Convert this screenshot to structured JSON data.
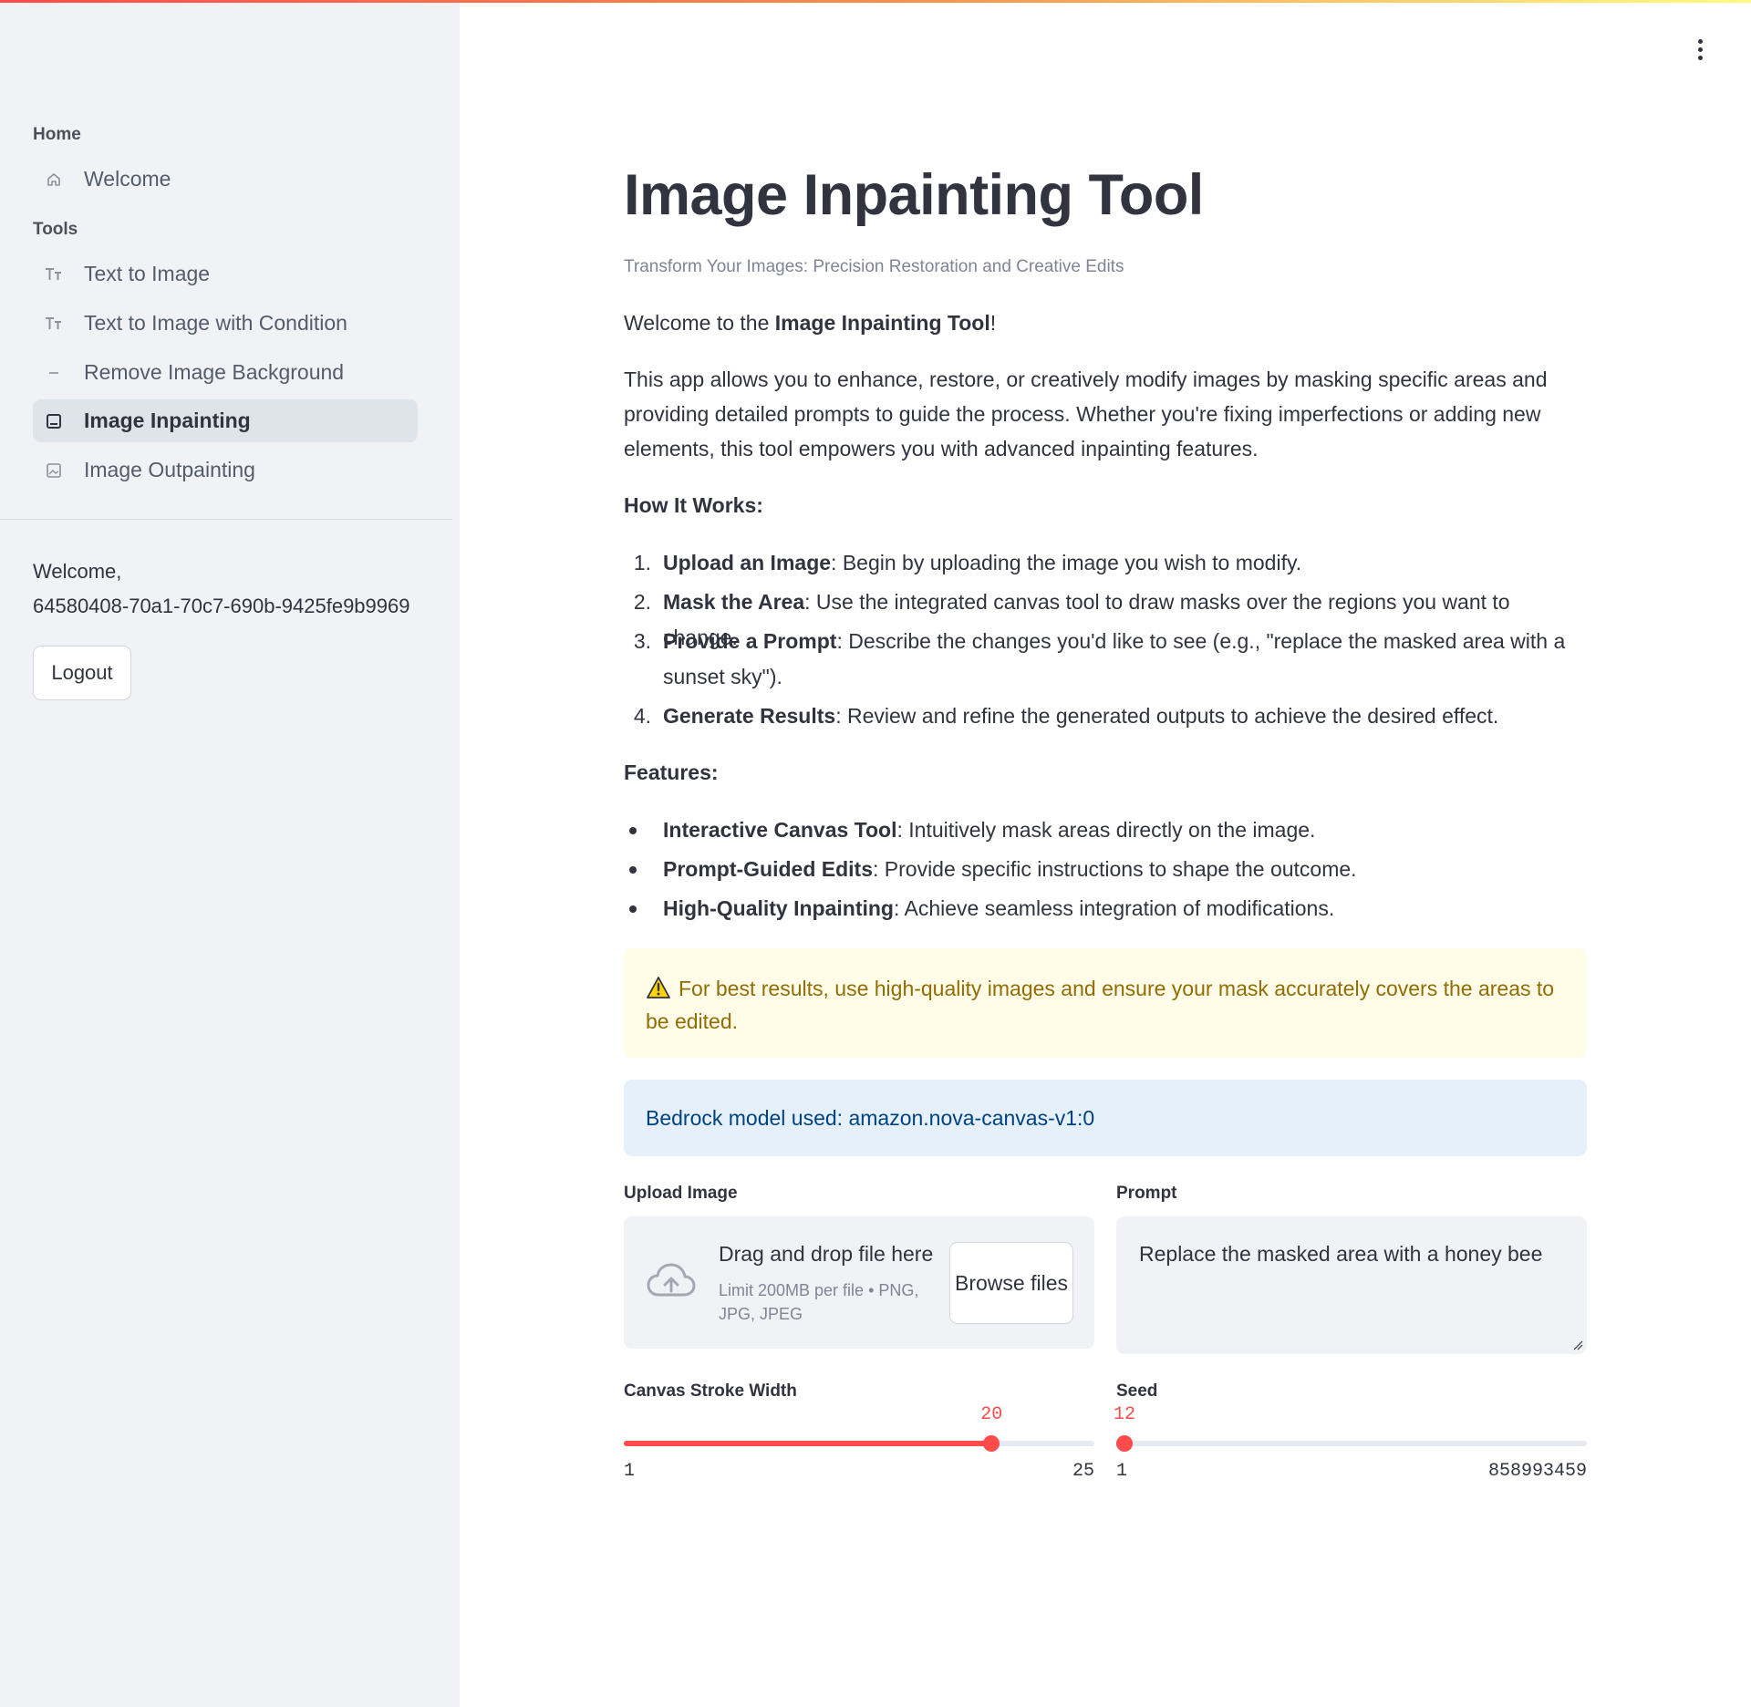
{
  "colors": {
    "primary": "#ff4b4b",
    "sidebar_bg": "#f0f2f6",
    "warning_bg": "#fffce7",
    "warning_text": "#926c05",
    "info_bg": "#e5f0fb",
    "info_text": "#004280"
  },
  "sidebar": {
    "sections": [
      {
        "title": "Home",
        "items": [
          {
            "label": "Welcome",
            "icon": "home-icon",
            "active": false
          }
        ]
      },
      {
        "title": "Tools",
        "items": [
          {
            "label": "Text to Image",
            "icon": "text-size-icon",
            "active": false
          },
          {
            "label": "Text to Image with Condition",
            "icon": "text-size-icon",
            "active": false
          },
          {
            "label": "Remove Image Background",
            "icon": "dash-icon",
            "active": false
          },
          {
            "label": "Image Inpainting",
            "icon": "image-icon",
            "active": true
          },
          {
            "label": "Image Outpainting",
            "icon": "image-icon",
            "active": false
          }
        ]
      }
    ],
    "welcome_label": "Welcome,",
    "user_id": "64580408-70a1-70c7-690b-9425fe9b9969",
    "logout_label": "Logout"
  },
  "main": {
    "title": "Image Inpainting Tool",
    "subtitle": "Transform Your Images: Precision Restoration and Creative Edits",
    "intro_prefix": "Welcome to the ",
    "intro_bold": "Image Inpainting Tool",
    "intro_suffix": "!",
    "description": "This app allows you to enhance, restore, or creatively modify images by masking specific areas and providing detailed prompts to guide the process. Whether you're fixing imperfections or adding new elements, this tool empowers you with advanced inpainting features.",
    "how_it_works_heading": "How It Works:",
    "steps": [
      {
        "num": "1.",
        "bold": "Upload an Image",
        "text": ": Begin by uploading the image you wish to modify."
      },
      {
        "num": "2.",
        "bold": "Mask the Area",
        "text": ": Use the integrated canvas tool to draw masks over the regions you want to change."
      },
      {
        "num": "3.",
        "bold": "Provide a Prompt",
        "text": ": Describe the changes you'd like to see (e.g., \"replace the masked area with a sunset sky\")."
      },
      {
        "num": "4.",
        "bold": "Generate Results",
        "text": ": Review and refine the generated outputs to achieve the desired effect."
      }
    ],
    "features_heading": "Features:",
    "features": [
      {
        "bold": "Interactive Canvas Tool",
        "text": ": Intuitively mask areas directly on the image."
      },
      {
        "bold": "Prompt-Guided Edits",
        "text": ": Provide specific instructions to shape the outcome."
      },
      {
        "bold": "High-Quality Inpainting",
        "text": ": Achieve seamless integration of modifications."
      }
    ],
    "warning": "For best results, use high-quality images and ensure your mask accurately covers the areas to be edited.",
    "info": "Bedrock model used: amazon.nova-canvas-v1:0",
    "upload": {
      "label": "Upload Image",
      "drag_text": "Drag and drop file here",
      "limit_text": "Limit 200MB per file • PNG, JPG, JPEG",
      "browse_label": "Browse files"
    },
    "prompt": {
      "label": "Prompt",
      "value": "Replace the masked area with a honey bee"
    },
    "stroke_slider": {
      "label": "Canvas Stroke Width",
      "value": 20,
      "min": 1,
      "max": 25
    },
    "seed_slider": {
      "label": "Seed",
      "value": 12,
      "min": 1,
      "max": 858993459
    }
  }
}
